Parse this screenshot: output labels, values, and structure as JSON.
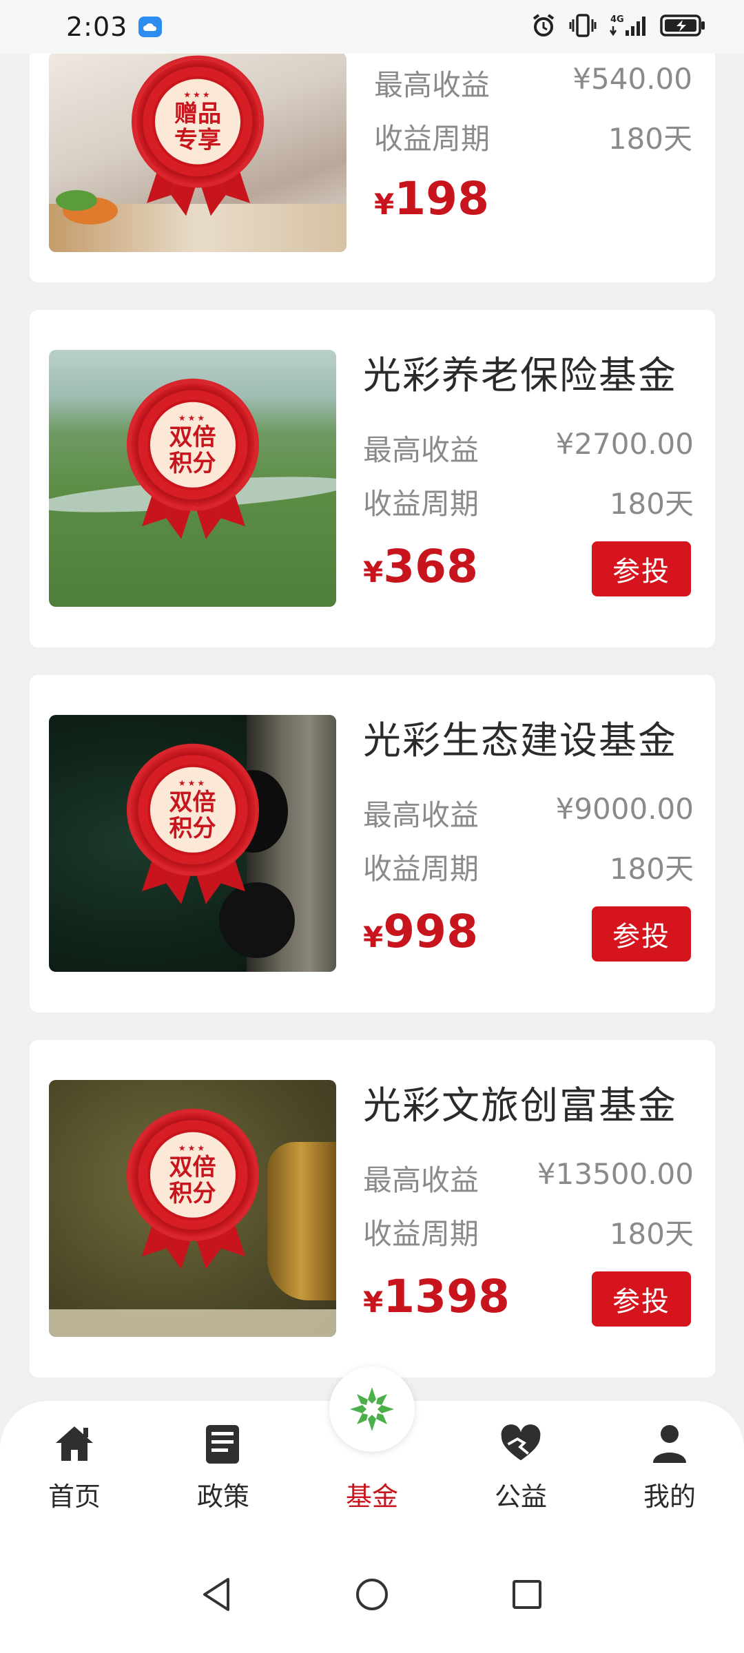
{
  "status_bar": {
    "time": "2:03",
    "network_label": "4G"
  },
  "cards": [
    {
      "title": "",
      "badge_text": "赠品专享",
      "max_return_label": "最高收益",
      "max_return_value": "¥540.00",
      "period_label": "收益周期",
      "period_value": "180天",
      "price_symbol": "¥",
      "price": "198",
      "button_label": ""
    },
    {
      "title": "光彩养老保险基金",
      "badge_text": "双倍积分",
      "max_return_label": "最高收益",
      "max_return_value": "¥2700.00",
      "period_label": "收益周期",
      "period_value": "180天",
      "price_symbol": "¥",
      "price": "368",
      "button_label": "参投"
    },
    {
      "title": "光彩生态建设基金",
      "badge_text": "双倍积分",
      "max_return_label": "最高收益",
      "max_return_value": "¥9000.00",
      "period_label": "收益周期",
      "period_value": "180天",
      "price_symbol": "¥",
      "price": "998",
      "button_label": "参投"
    },
    {
      "title": "光彩文旅创富基金",
      "badge_text": "双倍积分",
      "max_return_label": "最高收益",
      "max_return_value": "¥13500.00",
      "period_label": "收益周期",
      "period_value": "180天",
      "price_symbol": "¥",
      "price": "1398",
      "button_label": "参投"
    }
  ],
  "bottom_nav": {
    "items": [
      {
        "label": "首页",
        "icon": "home-icon"
      },
      {
        "label": "政策",
        "icon": "document-icon"
      },
      {
        "label": "基金",
        "icon": "fund-logo-icon",
        "active": true
      },
      {
        "label": "公益",
        "icon": "heart-hand-icon"
      },
      {
        "label": "我的",
        "icon": "user-icon"
      }
    ]
  },
  "colors": {
    "accent": "#c8141c",
    "background": "#f0f0f0",
    "card": "#ffffff",
    "muted_text": "#8a8a8a"
  }
}
